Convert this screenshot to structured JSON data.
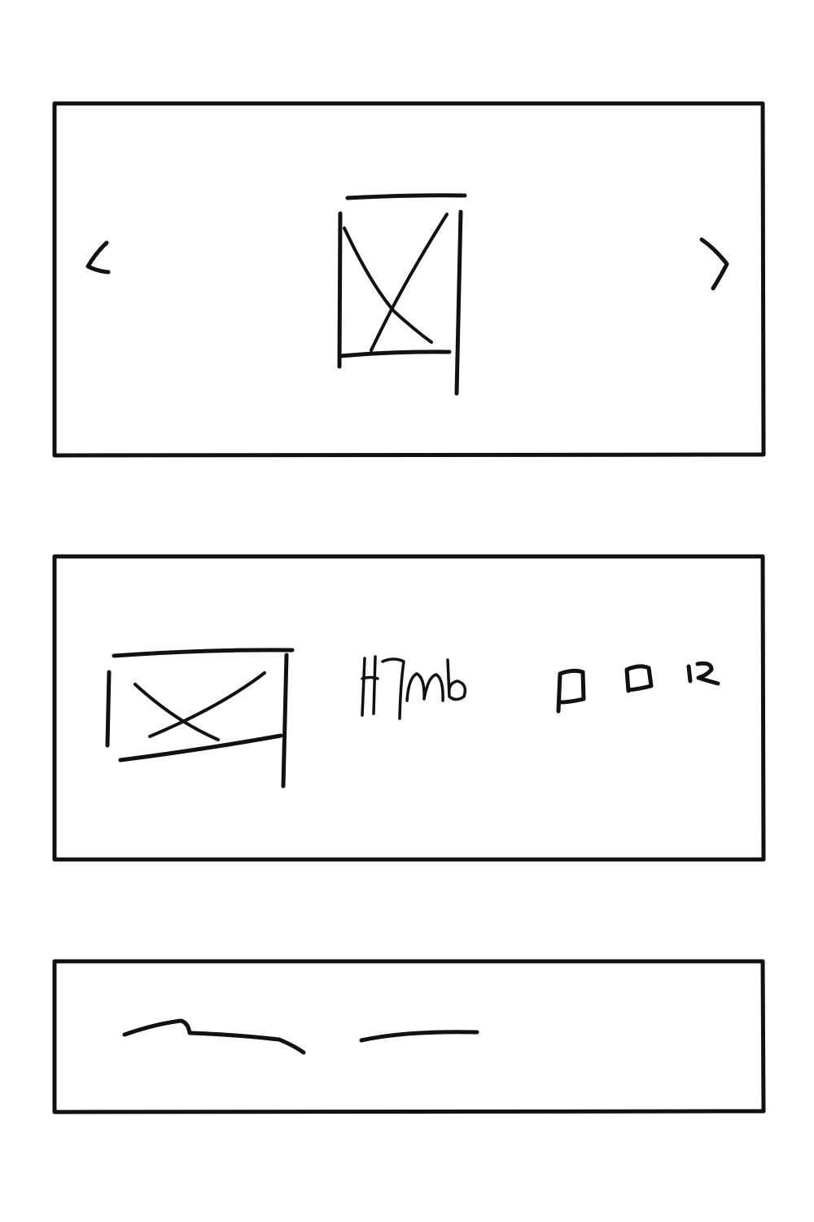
{
  "wireframe": {
    "carousel": {
      "prev_icon": "chevron-left-icon",
      "next_icon": "chevron-right-icon",
      "slide_image": "image-placeholder-icon"
    },
    "content_card": {
      "thumbnail": "image-placeholder-icon",
      "heading_scribble": "H7Mb",
      "action_icons": [
        "square-icon",
        "square-icon",
        "square-icon"
      ]
    },
    "footer_bar": {
      "text_lines": 2
    }
  }
}
